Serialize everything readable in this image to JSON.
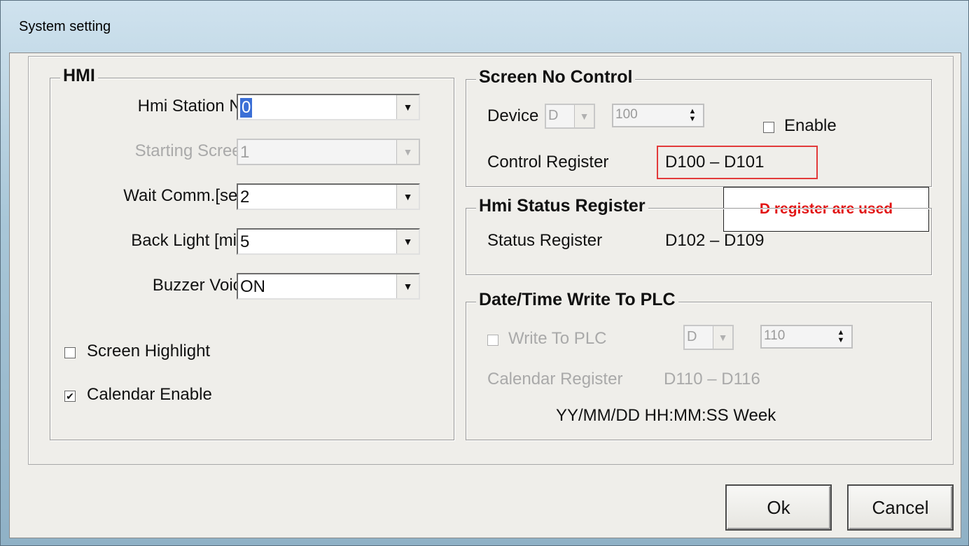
{
  "window": {
    "title": "System setting"
  },
  "hmi": {
    "group_title": "HMI",
    "station_no": {
      "label": "Hmi Station No",
      "value": "0"
    },
    "starting_screen": {
      "label": "Starting Screen",
      "value": "1"
    },
    "wait_comm": {
      "label": "Wait Comm.[sec]",
      "value": "2"
    },
    "back_light": {
      "label": "Back Light [min]",
      "value": "5"
    },
    "buzzer": {
      "label": "Buzzer Voice",
      "value": "ON"
    },
    "screen_highlight": {
      "label": "Screen Highlight",
      "checked": false
    },
    "calendar_enable": {
      "label": "Calendar Enable",
      "checked": true
    }
  },
  "screen_no_control": {
    "group_title": "Screen No Control",
    "device_label": "Device",
    "device_value": "D",
    "address_value": "100",
    "enable_label": "Enable",
    "control_register_label": "Control Register",
    "control_register_value": "D100 – D101"
  },
  "annotation": {
    "callout_text": "D register are used"
  },
  "hmi_status": {
    "group_title": "Hmi Status Register",
    "status_label": "Status Register",
    "status_value": "D102 – D109"
  },
  "datetime": {
    "group_title": "Date/Time Write To PLC",
    "write_label": "Write To PLC",
    "device_value": "D",
    "address_value": "110",
    "calendar_register_label": "Calendar Register",
    "calendar_register_value": "D110 – D116",
    "format": "YY/MM/DD HH:MM:SS Week"
  },
  "buttons": {
    "ok": "Ok",
    "cancel": "Cancel"
  }
}
